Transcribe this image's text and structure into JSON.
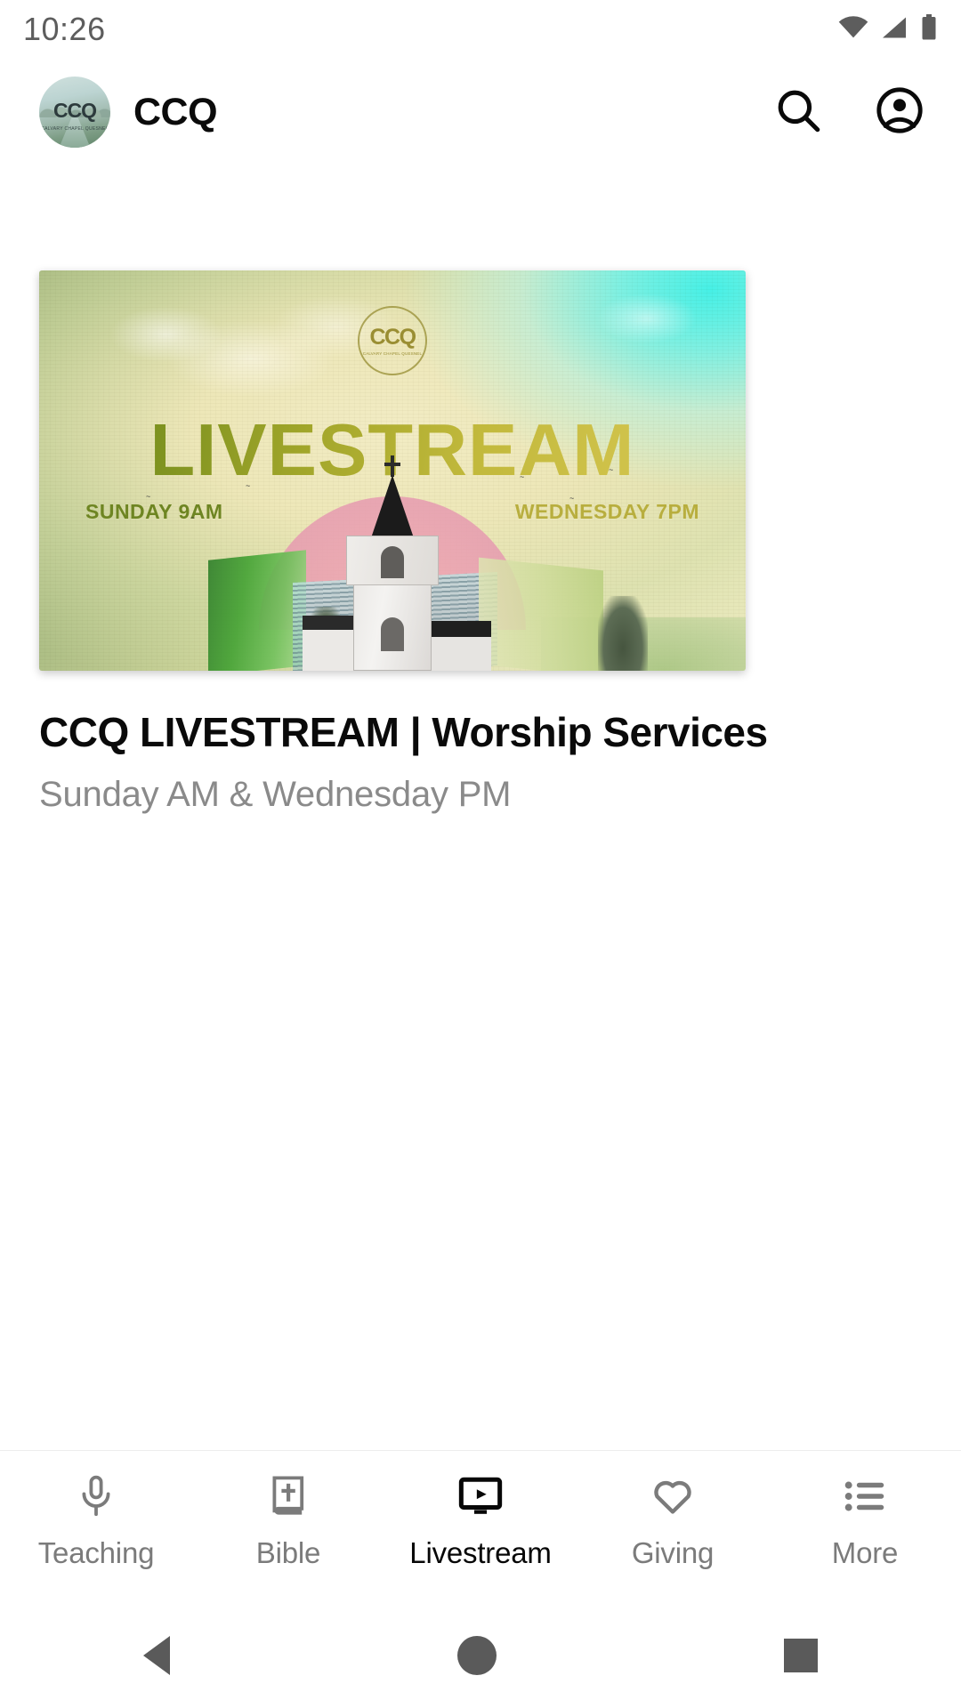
{
  "status_bar": {
    "time": "10:26",
    "icons": [
      "wifi-icon",
      "cellular-icon",
      "battery-icon"
    ]
  },
  "app_bar": {
    "logo_text": "CCQ",
    "logo_subtext": "CALVARY CHAPEL QUESNEL",
    "brand_name": "CCQ",
    "search_icon": "search-icon",
    "account_icon": "account-circle-icon"
  },
  "hero": {
    "logo_text": "CCQ",
    "logo_subtext": "CALVARY CHAPEL QUESNEL",
    "headline": "LIVESTREAM",
    "time_left": "SUNDAY 9AM",
    "time_right": "WEDNESDAY 7PM"
  },
  "item": {
    "title": "CCQ LIVESTREAM | Worship Services",
    "subtitle": "Sunday AM & Wednesday PM"
  },
  "tabs": [
    {
      "label": "Teaching",
      "icon": "microphone-icon",
      "active": false
    },
    {
      "label": "Bible",
      "icon": "bible-book-icon",
      "active": false
    },
    {
      "label": "Livestream",
      "icon": "video-monitor-icon",
      "active": true
    },
    {
      "label": "Giving",
      "icon": "heart-icon",
      "active": false
    },
    {
      "label": "More",
      "icon": "list-menu-icon",
      "active": false
    }
  ],
  "system_nav": {
    "back": "back-triangle-icon",
    "home": "home-circle-icon",
    "recents": "recents-square-icon"
  },
  "colors": {
    "active": "#070707",
    "inactive": "#7b7b7b",
    "subtitle": "#8a8a8a",
    "status": "#5d5d5d"
  }
}
